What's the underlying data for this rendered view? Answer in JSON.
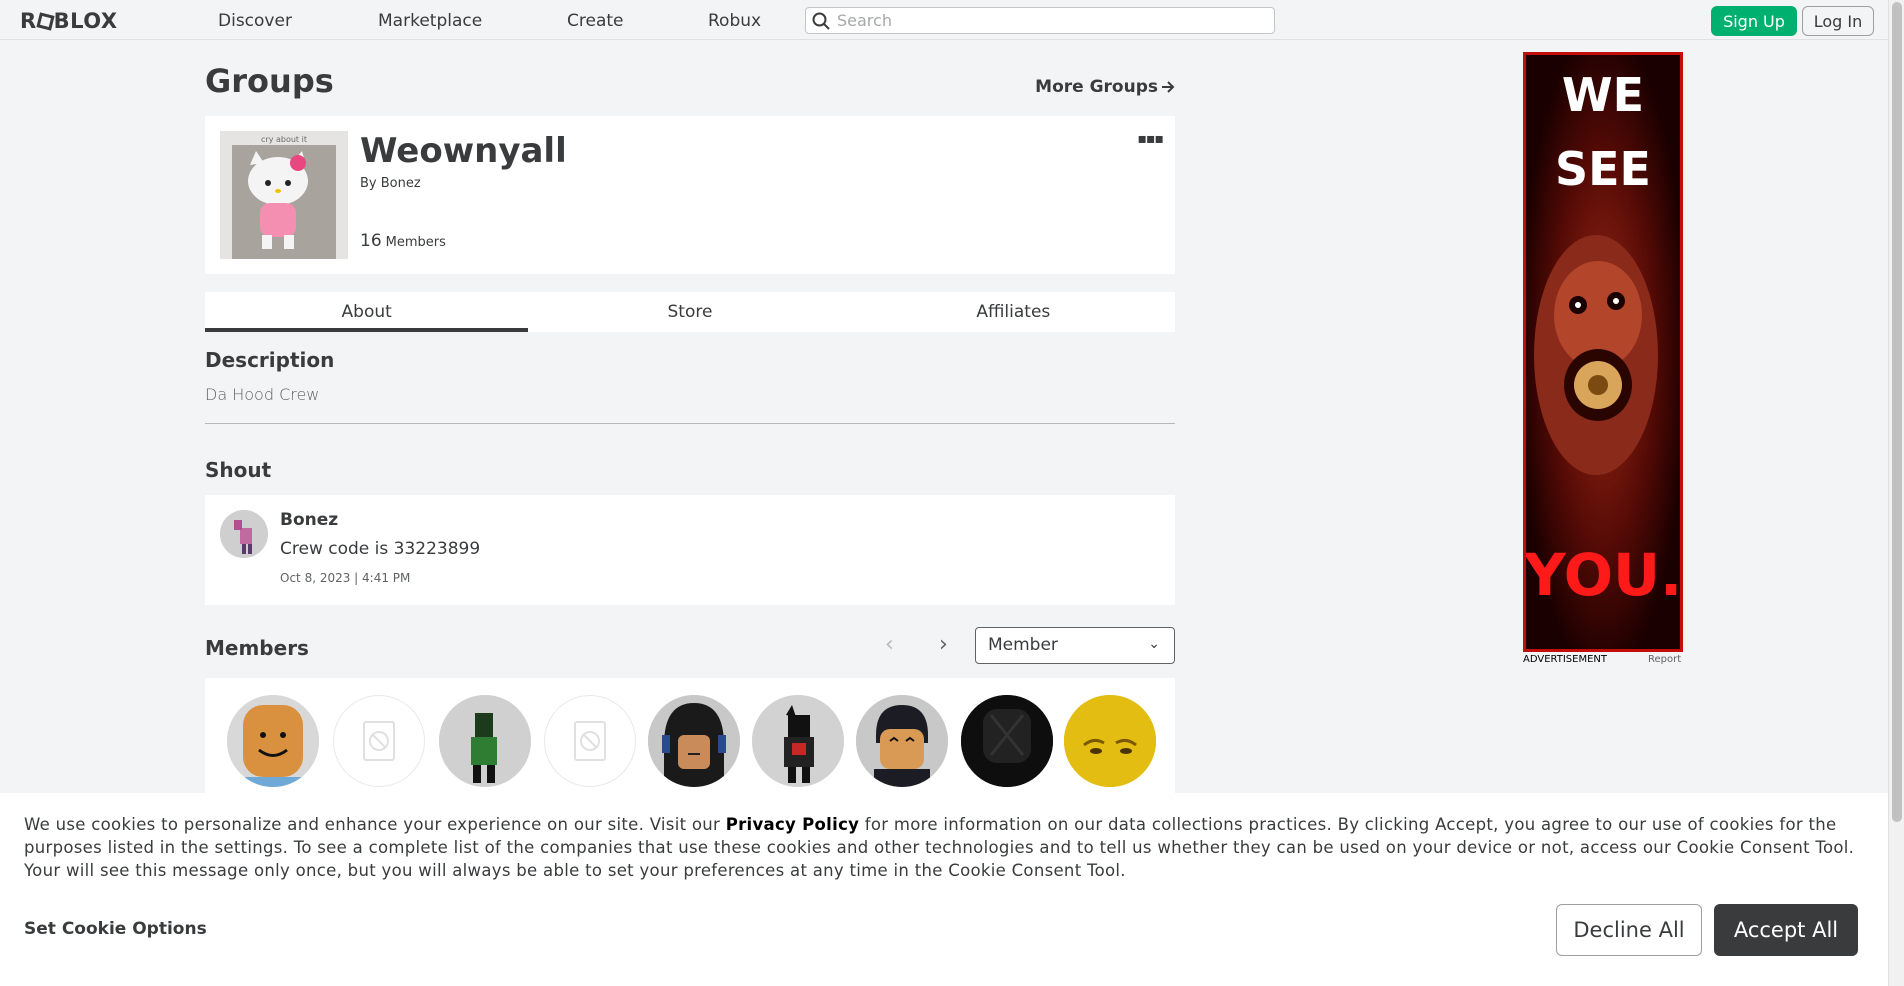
{
  "nav": {
    "logo": "RBLOX",
    "links": [
      "Discover",
      "Marketplace",
      "Create",
      "Robux"
    ],
    "search_placeholder": "Search",
    "signup": "Sign Up",
    "login": "Log In"
  },
  "page": {
    "title": "Groups",
    "more_groups": "More Groups"
  },
  "group": {
    "name": "Weownyall",
    "by_prefix": "By",
    "owner": "Bonez",
    "member_count": "16",
    "member_label": "Members",
    "thumbnail_caption": "cry about it"
  },
  "tabs": [
    "About",
    "Store",
    "Affiliates"
  ],
  "description": {
    "heading": "Description",
    "text": "Da Hood Crew"
  },
  "shout": {
    "heading": "Shout",
    "user": "Bonez",
    "text": "Crew code is 33223899",
    "date": "Oct 8, 2023 | 4:41 PM"
  },
  "members": {
    "heading": "Members",
    "role_selected": "Member"
  },
  "ad": {
    "line1": "WE",
    "line2": "SEE",
    "line3": "YOU.",
    "label": "ADVERTISEMENT",
    "report": "Report"
  },
  "cookie": {
    "text_before": "We use cookies to personalize and enhance your experience on our site. Visit our ",
    "link": "Privacy Policy",
    "text_after": " for more information on our data collections practices. By clicking Accept, you agree to our use of cookies for the purposes listed in the settings. To see a complete list of the companies that use these cookies and other technologies and to tell us whether they can be used on your device or not, access our Cookie Consent Tool. Your will see this message only once, but you will always be able to set your preferences at any time in the Cookie Consent Tool.",
    "options": "Set Cookie Options",
    "decline": "Decline All",
    "accept": "Accept All"
  }
}
